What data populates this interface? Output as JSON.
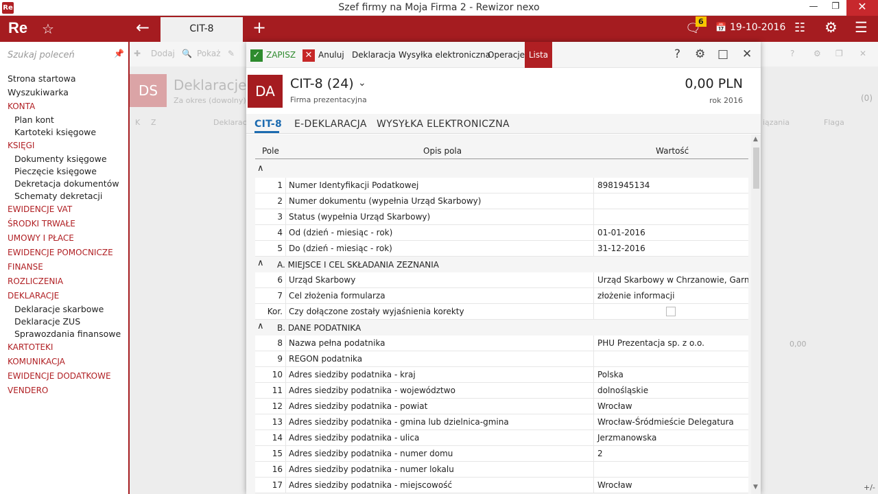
{
  "window": {
    "title": "Szef firmy na Moja Firma 2 - Rewizor nexo",
    "icon_text": "Re"
  },
  "appbar": {
    "logo": "Re",
    "active_tab": "CIT-8",
    "notification_count": "6",
    "date": "19-10-2016",
    "color": "#a51c20"
  },
  "sidebar": {
    "search_placeholder": "Szukaj poleceń",
    "items": [
      {
        "label": "Strona startowa",
        "type": "item"
      },
      {
        "label": "Wyszukiwarka",
        "type": "item"
      },
      {
        "label": "KONTA",
        "type": "cat"
      },
      {
        "label": "Plan kont",
        "type": "sub"
      },
      {
        "label": "Kartoteki księgowe",
        "type": "sub"
      },
      {
        "label": "KSIĘGI",
        "type": "cat"
      },
      {
        "label": "Dokumenty księgowe",
        "type": "sub"
      },
      {
        "label": "Pieczęcie księgowe",
        "type": "sub"
      },
      {
        "label": "Dekretacja dokumentów",
        "type": "sub"
      },
      {
        "label": "Schematy dekretacji",
        "type": "sub"
      },
      {
        "label": "EWIDENCJE VAT",
        "type": "cat"
      },
      {
        "label": "ŚRODKI TRWAŁE",
        "type": "cat"
      },
      {
        "label": "UMOWY I PŁACE",
        "type": "cat"
      },
      {
        "label": "EWIDENCJE POMOCNICZE",
        "type": "cat"
      },
      {
        "label": "FINANSE",
        "type": "cat"
      },
      {
        "label": "ROZLICZENIA",
        "type": "cat"
      },
      {
        "label": "DEKLARACJE",
        "type": "cat"
      },
      {
        "label": "Deklaracje skarbowe",
        "type": "sub"
      },
      {
        "label": "Deklaracje ZUS",
        "type": "sub"
      },
      {
        "label": "Sprawozdania finansowe",
        "type": "sub"
      },
      {
        "label": "KARTOTEKI",
        "type": "cat"
      },
      {
        "label": "KOMUNIKACJA",
        "type": "cat"
      },
      {
        "label": "EWIDENCJE DODATKOWE",
        "type": "cat"
      },
      {
        "label": "VENDERO",
        "type": "cat"
      }
    ]
  },
  "background": {
    "toolbar": {
      "add": "Dodaj",
      "show": "Pokaż"
    },
    "badge": "DS",
    "title": "Deklaracje s",
    "subtitle": "Za okres (dowolny)",
    "headers": {
      "k": "K",
      "z": "Z",
      "dekl": "Deklarac",
      "wiaz": "iązania",
      "flaga": "Flaga"
    },
    "count": "(0)",
    "sum": "0,00",
    "plusminus": "+/-"
  },
  "modal": {
    "toolbar": {
      "save": "ZAPISZ",
      "cancel": "Anuluj",
      "declaration": "Deklaracja",
      "send": "Wysyłka elektroniczna",
      "operations": "Operacje",
      "list": "Lista"
    },
    "header": {
      "badge": "DA",
      "document": "CIT-8 (24)",
      "firm": "Firma prezentacyjna",
      "amount": "0,00 PLN",
      "year": "rok 2016"
    },
    "tabs": [
      "CIT-8",
      "E-DEKLARACJA",
      "WYSYŁKA ELEKTRONICZNA"
    ],
    "grid": {
      "headers": {
        "field": "Pole",
        "desc": "Opis pola",
        "value": "Wartość"
      },
      "rows": [
        {
          "type": "section",
          "title": ""
        },
        {
          "type": "data",
          "n": "1",
          "desc": "Numer Identyfikacji Podatkowej",
          "value": "8981945134"
        },
        {
          "type": "data",
          "n": "2",
          "desc": "Numer dokumentu (wypełnia Urząd Skarbowy)",
          "value": ""
        },
        {
          "type": "data",
          "n": "3",
          "desc": "Status (wypełnia Urząd Skarbowy)",
          "value": ""
        },
        {
          "type": "data",
          "n": "4",
          "desc": "Od (dzień - miesiąc - rok)",
          "value": "01-01-2016"
        },
        {
          "type": "data",
          "n": "5",
          "desc": "Do (dzień - miesiąc - rok)",
          "value": "31-12-2016"
        },
        {
          "type": "section",
          "title": "A. MIEJSCE I CEL SKŁADANIA ZEZNANIA"
        },
        {
          "type": "data",
          "n": "6",
          "desc": "Urząd Skarbowy",
          "value": "Urząd Skarbowy w Chrzanowie, Garnca..."
        },
        {
          "type": "data",
          "n": "7",
          "desc": "Cel złożenia formularza",
          "value": "złożenie informacji"
        },
        {
          "type": "check",
          "n": "Kor.",
          "desc": "Czy dołączone zostały wyjaśnienia korekty",
          "value": ""
        },
        {
          "type": "section",
          "title": "B. DANE PODATNIKA"
        },
        {
          "type": "data",
          "n": "8",
          "desc": "Nazwa pełna podatnika",
          "value": "PHU Prezentacja sp. z o.o."
        },
        {
          "type": "data",
          "n": "9",
          "desc": "REGON podatnika",
          "value": ""
        },
        {
          "type": "data",
          "n": "10",
          "desc": "Adres siedziby podatnika - kraj",
          "value": "Polska"
        },
        {
          "type": "data",
          "n": "11",
          "desc": "Adres siedziby podatnika - województwo",
          "value": "dolnośląskie"
        },
        {
          "type": "data",
          "n": "12",
          "desc": "Adres siedziby podatnika - powiat",
          "value": "Wrocław"
        },
        {
          "type": "data",
          "n": "13",
          "desc": "Adres siedziby podatnika - gmina lub dzielnica-gmina",
          "value": "Wrocław-Śródmieście Delegatura"
        },
        {
          "type": "data",
          "n": "14",
          "desc": "Adres siedziby podatnika - ulica",
          "value": "Jerzmanowska"
        },
        {
          "type": "data",
          "n": "15",
          "desc": "Adres siedziby podatnika - numer domu",
          "value": "2"
        },
        {
          "type": "data",
          "n": "16",
          "desc": "Adres siedziby podatnika - numer lokalu",
          "value": ""
        },
        {
          "type": "data",
          "n": "17",
          "desc": "Adres siedziby podatnika - miejscowość",
          "value": "Wrocław"
        }
      ]
    }
  }
}
